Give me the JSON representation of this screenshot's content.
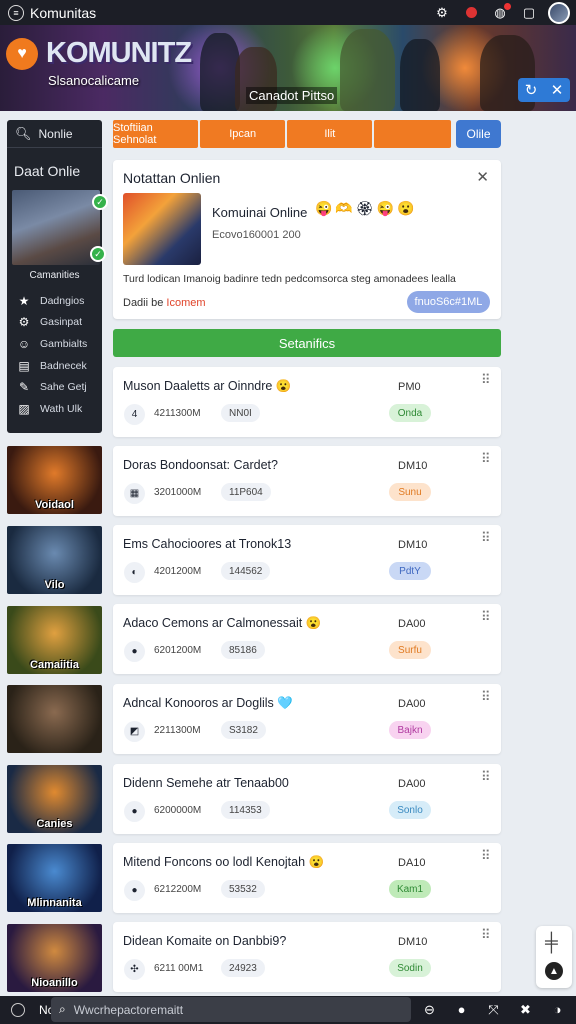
{
  "app": {
    "title": "Komunitas"
  },
  "banner": {
    "logo_text": "KOMUNITZ",
    "subtitle": "Slsanocalicame",
    "tag": "Canadot Pittso"
  },
  "sidebar": {
    "search_label": "Nonlie",
    "heading": "Daat Onlie",
    "thumb_label": "Camanities",
    "items": [
      {
        "label": "Dadngios",
        "icon": "star-icon"
      },
      {
        "label": "Gasinpat",
        "icon": "gear-icon"
      },
      {
        "label": "Gambialts",
        "icon": "user-icon"
      },
      {
        "label": "Badnecek",
        "icon": "document-icon"
      },
      {
        "label": "Sahe Getj",
        "icon": "pencil-icon"
      },
      {
        "label": "Wath Ulk",
        "icon": "image-icon"
      }
    ]
  },
  "tiles": [
    {
      "label": "Voidaol",
      "colors": [
        "#3a1a10",
        "#e07a2a"
      ]
    },
    {
      "label": "Vilo",
      "colors": [
        "#1a2a40",
        "#6a8ab0"
      ]
    },
    {
      "label": "Camaiitia",
      "colors": [
        "#3a4a1a",
        "#e0a040"
      ]
    },
    {
      "label": "",
      "colors": [
        "#2a2218",
        "#8a6a50"
      ]
    },
    {
      "label": "Canies",
      "colors": [
        "#1a2a45",
        "#e08a30"
      ]
    },
    {
      "label": "Mlinnanita",
      "colors": [
        "#10204a",
        "#4a8ad0"
      ]
    },
    {
      "label": "Nioanillo",
      "colors": [
        "#2a1a40",
        "#d08a40"
      ]
    }
  ],
  "tabs": [
    "Stoftiian Sehnolat",
    "Ipcan",
    "Ilit",
    ""
  ],
  "online_button": "Olile",
  "notification": {
    "title": "Notattan Onlien",
    "name": "Komuinai Online",
    "emojis": "😜🫶🏵😜😮",
    "code": "Ecovo160001 200",
    "description": "Turd lodican Imanoig badinre tedn pedcomsorca steg amonadees lealla",
    "by_prefix": "Dadii be",
    "by_name": "Icomem",
    "chip": "fnuoS6c#1ML"
  },
  "status_bar": "Setanifics",
  "cards": [
    {
      "title": "Muson Daaletts ar Oinndre 😮",
      "date": "PM0",
      "avatar": "4",
      "num": "4211300M",
      "badge": "NN0I",
      "pill": "Onda",
      "pill_bg": "#d8f2d8",
      "pill_fg": "#2f8a35"
    },
    {
      "title": "Doras Bondoonsat: Cardet?",
      "date": "DM10",
      "avatar": "▦",
      "num": "3201000M",
      "badge": "11P604",
      "pill": "Sunu",
      "pill_bg": "#fde3cc",
      "pill_fg": "#e07a22"
    },
    {
      "title": "Ems Cahocioores at Tronok13",
      "date": "DM10",
      "avatar": "◐",
      "num": "4201200M",
      "badge": "144562",
      "pill": "PdtY",
      "pill_bg": "#c9d8f5",
      "pill_fg": "#3f68c0"
    },
    {
      "title": "Adaco Cemons ar Calmonessait 😮",
      "date": "DA00",
      "avatar": "●",
      "num": "6201200M",
      "badge": "85186",
      "pill": "Surfu",
      "pill_bg": "#fde3cc",
      "pill_fg": "#e07a22"
    },
    {
      "title": "Adncal Konooros ar Doglils 🩵",
      "date": "DA00",
      "avatar": "◩",
      "num": "2211300M",
      "badge": "S3182",
      "pill": "Bajkn",
      "pill_bg": "#f8d3f0",
      "pill_fg": "#b03aa0"
    },
    {
      "title": "Didenn Semehe atr Tenaab00",
      "date": "DA00",
      "avatar": "●",
      "num": "6200000M",
      "badge": "114353",
      "pill": "Sonlo",
      "pill_bg": "#d6ecf8",
      "pill_fg": "#3a8ac0"
    },
    {
      "title": "Mitend Foncons oo lodl Kenojtah 😮",
      "date": "DA10",
      "avatar": "●",
      "num": "6212200M",
      "badge": "53532",
      "pill": "Kam1",
      "pill_bg": "#bfeab8",
      "pill_fg": "#2f8a35"
    },
    {
      "title": "Didean Komaite on Danbbi9?",
      "date": "DM10",
      "avatar": "✣",
      "num": "6211 00M1",
      "badge": "24923",
      "pill": "Sodin",
      "pill_bg": "#d8f2d8",
      "pill_fg": "#2f8a35"
    }
  ],
  "bottom": {
    "m_label": "Nc",
    "search_placeholder": "Wwcrhepactoremaitt"
  }
}
